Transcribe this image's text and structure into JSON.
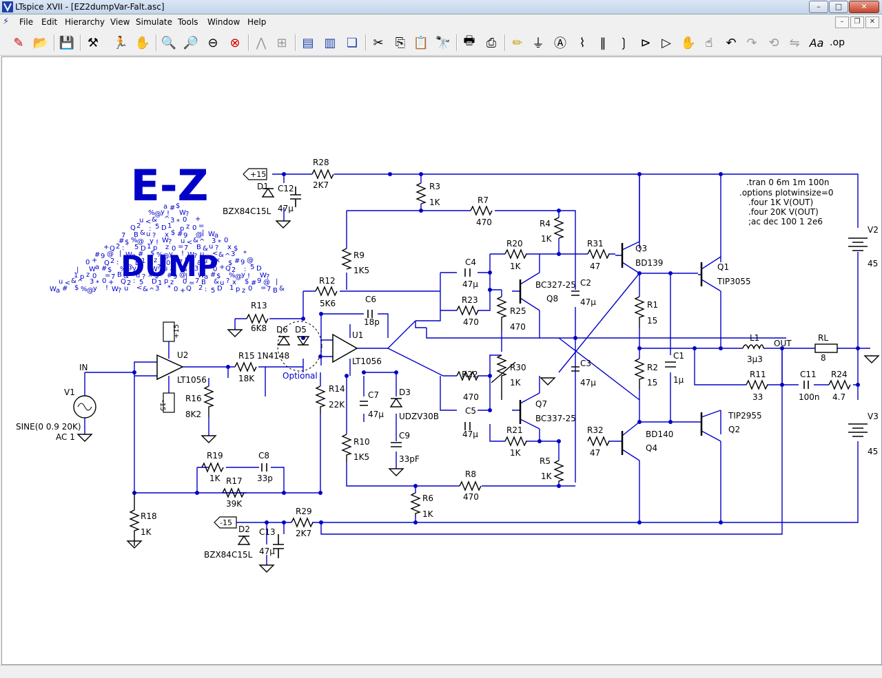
{
  "window": {
    "title": "LTspice XVII - [EZ2dumpVar-Falt.asc]",
    "controls": {
      "minimize": "–",
      "maximize": "□",
      "close": "✕"
    },
    "mdi_controls": {
      "minimize": "–",
      "restore": "❐",
      "close": "✕"
    }
  },
  "menu": [
    "File",
    "Edit",
    "Hierarchy",
    "View",
    "Simulate",
    "Tools",
    "Window",
    "Help"
  ],
  "toolbar_icons": [
    "new-schematic-icon",
    "open-icon",
    "save-icon",
    "control-panel-icon",
    "run-icon",
    "halt-icon",
    "zoom-in-icon",
    "pan-icon",
    "zoom-out-icon",
    "zoom-fit-icon",
    "autoscale-icon",
    "grid-icon",
    "tile-horizontal-icon",
    "tile-vertical-icon",
    "cascade-icon",
    "cut-icon",
    "copy-icon",
    "paste-icon",
    "find-icon",
    "print-setup-icon",
    "print-icon",
    "draw-wire-icon",
    "ground-icon",
    "label-net-icon",
    "resistor-icon",
    "capacitor-icon",
    "inductor-icon",
    "diode-icon",
    "component-icon",
    "move-icon",
    "drag-icon",
    "undo-icon",
    "redo-icon",
    "rotate-icon",
    "mirror-icon",
    "text-icon",
    "spice-directive-icon"
  ],
  "colors": {
    "wire": "#0000c8",
    "label": "#000000",
    "logo": "#0000c8",
    "background": "#ffffff"
  },
  "logo": {
    "line1": "E-Z",
    "line2": "DUMP",
    "scatter": "a#$%@y!W?u<&^3*0+Q2:5D1pz0=7B&u?x$#9@|W"
  },
  "spice_directives": [
    ".tran 0 6m 1m 100n",
    ".options plotwinsize=0",
    ".four 1K V(OUT)",
    ".four 20K V(OUT)",
    ";ac dec 100 1 2e6"
  ],
  "net_labels": {
    "pos": "+15",
    "neg": "-15",
    "in": "IN",
    "out": "OUT",
    "optional": "Optional",
    "u2_plus": "+15",
    "u2_minus": "-15"
  },
  "components": {
    "R28": {
      "name": "R28",
      "value": "2K7"
    },
    "R3": {
      "name": "R3",
      "value": "1K"
    },
    "R7": {
      "name": "R7",
      "value": "470"
    },
    "R4": {
      "name": "R4",
      "value": "1K"
    },
    "R20": {
      "name": "R20",
      "value": "1K"
    },
    "R31": {
      "name": "R31",
      "value": "47"
    },
    "R9": {
      "name": "R9",
      "value": "1K5"
    },
    "R12": {
      "name": "R12",
      "value": "5K6"
    },
    "R13": {
      "name": "R13",
      "value": "6K8"
    },
    "R23": {
      "name": "R23",
      "value": "470"
    },
    "R25": {
      "name": "R25",
      "value": "470"
    },
    "R1": {
      "name": "R1",
      "value": "15"
    },
    "R2": {
      "name": "R2",
      "value": "15"
    },
    "R15": {
      "name": "R15",
      "value": "18K"
    },
    "R16": {
      "name": "R16",
      "value": "8K2"
    },
    "R14": {
      "name": "R14",
      "value": "22K"
    },
    "R22": {
      "name": "R22",
      "value": "470"
    },
    "R30": {
      "name": "R30",
      "value": "1K"
    },
    "R11": {
      "name": "R11",
      "value": "33"
    },
    "R24": {
      "name": "R24",
      "value": "4.7"
    },
    "R10": {
      "name": "R10",
      "value": "1K5"
    },
    "R21": {
      "name": "R21",
      "value": "1K"
    },
    "R32": {
      "name": "R32",
      "value": "47"
    },
    "R5": {
      "name": "R5",
      "value": "1K"
    },
    "R19": {
      "name": "R19",
      "value": "1K"
    },
    "R17": {
      "name": "R17",
      "value": "39K"
    },
    "R8": {
      "name": "R8",
      "value": "470"
    },
    "R6": {
      "name": "R6",
      "value": "1K"
    },
    "R18": {
      "name": "R18",
      "value": "1K"
    },
    "R29": {
      "name": "R29",
      "value": "2K7"
    },
    "RL": {
      "name": "RL",
      "value": "8"
    },
    "C12": {
      "name": "C12",
      "value": "47µ"
    },
    "C4": {
      "name": "C4",
      "value": "47µ"
    },
    "C2": {
      "name": "C2",
      "value": "47µ"
    },
    "C6": {
      "name": "C6",
      "value": "18p"
    },
    "C3": {
      "name": "C3",
      "value": "47µ"
    },
    "C1": {
      "name": "C1",
      "value": "1µ"
    },
    "C7": {
      "name": "C7",
      "value": "47µ"
    },
    "C5": {
      "name": "C5",
      "value": "47µ"
    },
    "C9": {
      "name": "C9",
      "value": "33pF"
    },
    "C11": {
      "name": "C11",
      "value": "100n"
    },
    "C8": {
      "name": "C8",
      "value": "33p"
    },
    "C13": {
      "name": "C13",
      "value": "47µ"
    },
    "L1": {
      "name": "L1",
      "value": "3µ3"
    },
    "D1": {
      "name": "D1",
      "value": "BZX84C15L"
    },
    "D2": {
      "name": "D2",
      "value": "BZX84C15L"
    },
    "D3": {
      "name": "D3",
      "value": "UDZV30B"
    },
    "D6": {
      "name": "D6",
      "value": "1N4148"
    },
    "D5": {
      "name": "D5",
      "value": ""
    },
    "Q3": {
      "name": "Q3",
      "value": "BD139"
    },
    "Q8": {
      "name": "Q8",
      "value": "BC327-25"
    },
    "Q7": {
      "name": "Q7",
      "value": "BC337-25"
    },
    "Q4": {
      "name": "Q4",
      "value": "BD140"
    },
    "Q1": {
      "name": "Q1",
      "value": "TIP3055"
    },
    "Q2": {
      "name": "Q2",
      "value": "TIP2955"
    },
    "U1": {
      "name": "U1",
      "value": "LT1056"
    },
    "U2": {
      "name": "U2",
      "value": "LT1056"
    },
    "V1": {
      "name": "V1",
      "value": "SINE(0 0.9 20K)",
      "ac": "AC 1"
    },
    "V2": {
      "name": "V2",
      "value": "45"
    },
    "V3": {
      "name": "V3",
      "value": "45"
    }
  }
}
